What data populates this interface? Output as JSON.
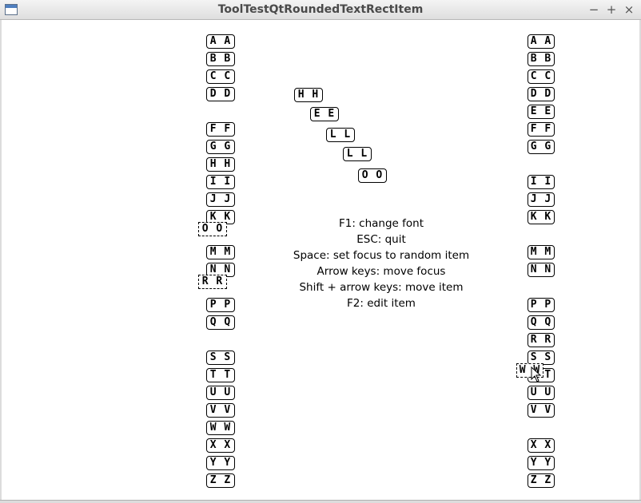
{
  "window": {
    "title": "ToolTestQtRoundedTextRectItem",
    "minimize_glyph": "−",
    "maximize_glyph": "+",
    "close_glyph": "×"
  },
  "help_lines": [
    "F1: change font",
    "ESC: quit",
    "Space: set focus to random item",
    "Arrow keys: move focus",
    "Shift + arrow keys: move item",
    "F2: edit item"
  ],
  "left_column": [
    {
      "text": "A A"
    },
    {
      "text": "B B"
    },
    {
      "text": "C C"
    },
    {
      "text": "D D"
    },
    {
      "text": "F F"
    },
    {
      "text": "G G"
    },
    {
      "text": "H H"
    },
    {
      "text": "I I"
    },
    {
      "text": "J J"
    },
    {
      "text": "K K"
    },
    {
      "text": "O O",
      "style": "dashed"
    },
    {
      "text": "M M"
    },
    {
      "text": "N N"
    },
    {
      "text": "R R",
      "style": "dashed"
    },
    {
      "text": "P P"
    },
    {
      "text": "Q Q"
    },
    {
      "text": "S S"
    },
    {
      "text": "T T"
    },
    {
      "text": "U U"
    },
    {
      "text": "V V"
    },
    {
      "text": "W W"
    },
    {
      "text": "X X"
    },
    {
      "text": "Y Y"
    },
    {
      "text": "Z Z"
    }
  ],
  "diagonal": [
    {
      "text": "H H"
    },
    {
      "text": "E E"
    },
    {
      "text": "L L"
    },
    {
      "text": "L L"
    },
    {
      "text": "O O"
    }
  ],
  "right_column": [
    {
      "text": "A A"
    },
    {
      "text": "B B"
    },
    {
      "text": "C C"
    },
    {
      "text": "D D"
    },
    {
      "text": "E E"
    },
    {
      "text": "F F"
    },
    {
      "text": "G G"
    },
    {
      "text": "I I"
    },
    {
      "text": "J J"
    },
    {
      "text": "K K"
    },
    {
      "text": "M M"
    },
    {
      "text": "N N"
    },
    {
      "text": "P P"
    },
    {
      "text": "Q Q"
    },
    {
      "text": "R R"
    },
    {
      "text": "S S"
    },
    {
      "text": "T T"
    },
    {
      "text": "W W",
      "style": "dashed"
    },
    {
      "text": "U U"
    },
    {
      "text": "V V"
    },
    {
      "text": "X X"
    },
    {
      "text": "Y Y"
    },
    {
      "text": "Z Z"
    }
  ]
}
